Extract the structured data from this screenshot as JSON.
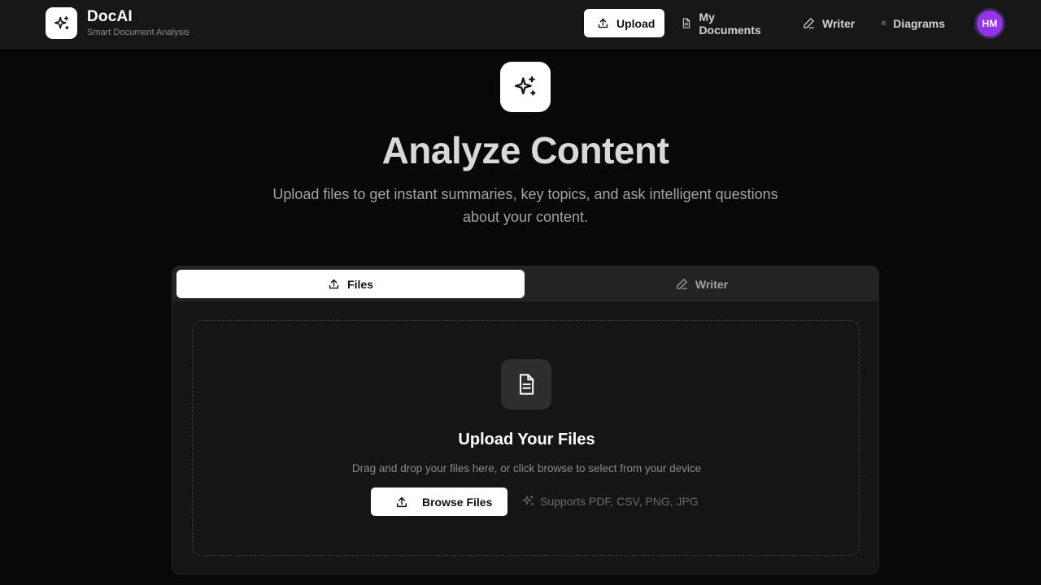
{
  "brand": {
    "name": "DocAI",
    "tagline": "Smart Document Analysis"
  },
  "nav": {
    "upload": "Upload",
    "my_documents": "My Documents",
    "writer": "Writer",
    "diagrams": "Diagrams"
  },
  "user": {
    "initials": "HM"
  },
  "hero": {
    "title": "Analyze Content",
    "subtitle": "Upload files to get instant summaries, key topics, and ask intelligent questions about your content."
  },
  "tabs": {
    "files": "Files",
    "writer": "Writer"
  },
  "dropzone": {
    "title": "Upload Your Files",
    "subtitle": "Drag and drop your files here, or click browse to select from your device",
    "browse_label": "Browse Files",
    "supports": "Supports PDF, CSV, PNG, JPG"
  },
  "colors": {
    "background": "#080808",
    "accent": "#9333ea",
    "surface": "#151515"
  },
  "icons": [
    "sparkles-icon",
    "upload-icon",
    "document-icon",
    "pencil-icon",
    "image-icon"
  ]
}
